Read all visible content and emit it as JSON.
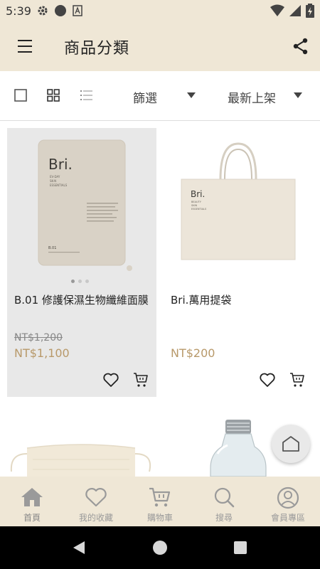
{
  "status_bar": {
    "time": "5:39"
  },
  "header": {
    "title": "商品分類"
  },
  "toolbar": {
    "filter_label": "篩選",
    "sort_label": "最新上架"
  },
  "products": [
    {
      "name": "B.01 修護保濕生物纖維面膜",
      "old_price": "NT$1,200",
      "price": "NT$1,100",
      "image_brand": "Bri.",
      "image_lines": [
        "EV-DAY",
        "SK-N",
        "ESSENTIALS"
      ],
      "image_code": "B.01"
    },
    {
      "name": "Bri.萬用提袋",
      "price": "NT$200",
      "image_brand": "Bri.",
      "image_lines": [
        "BEAUTY",
        "SKIN",
        "ESSENTIALS"
      ]
    }
  ],
  "bottom_nav": [
    {
      "label": "首頁",
      "icon": "home-icon"
    },
    {
      "label": "我的收藏",
      "icon": "heart-icon"
    },
    {
      "label": "購物車",
      "icon": "cart-icon"
    },
    {
      "label": "搜尋",
      "icon": "search-icon"
    },
    {
      "label": "會員專區",
      "icon": "user-icon"
    }
  ],
  "colors": {
    "accent_bar": "#efe7d6",
    "price": "#b8996a",
    "nav_text": "#9a9a9a"
  }
}
